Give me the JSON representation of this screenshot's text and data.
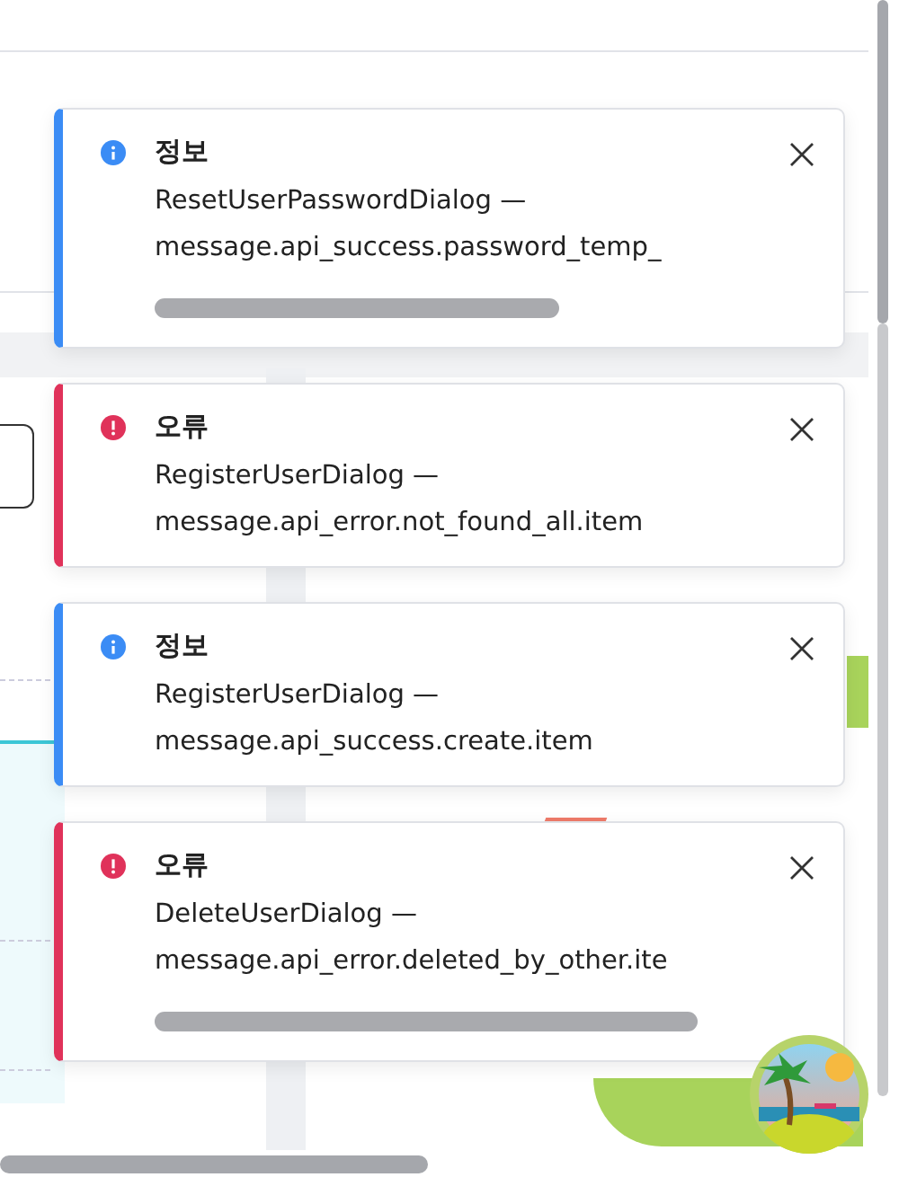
{
  "toasts": [
    {
      "kind": "info",
      "title": "정보",
      "source": "ResetUserPasswordDialog —",
      "message": "message.api_success.password_temp_",
      "scrollable": true
    },
    {
      "kind": "error",
      "title": "오류",
      "source": "RegisterUserDialog —",
      "message": "message.api_error.not_found_all.item",
      "scrollable": false
    },
    {
      "kind": "info",
      "title": "정보",
      "source": "RegisterUserDialog —",
      "message": "message.api_success.create.item",
      "scrollable": false
    },
    {
      "kind": "error",
      "title": "오류",
      "source": "DeleteUserDialog —",
      "message": "message.api_error.deleted_by_other.ite",
      "scrollable": true
    }
  ]
}
